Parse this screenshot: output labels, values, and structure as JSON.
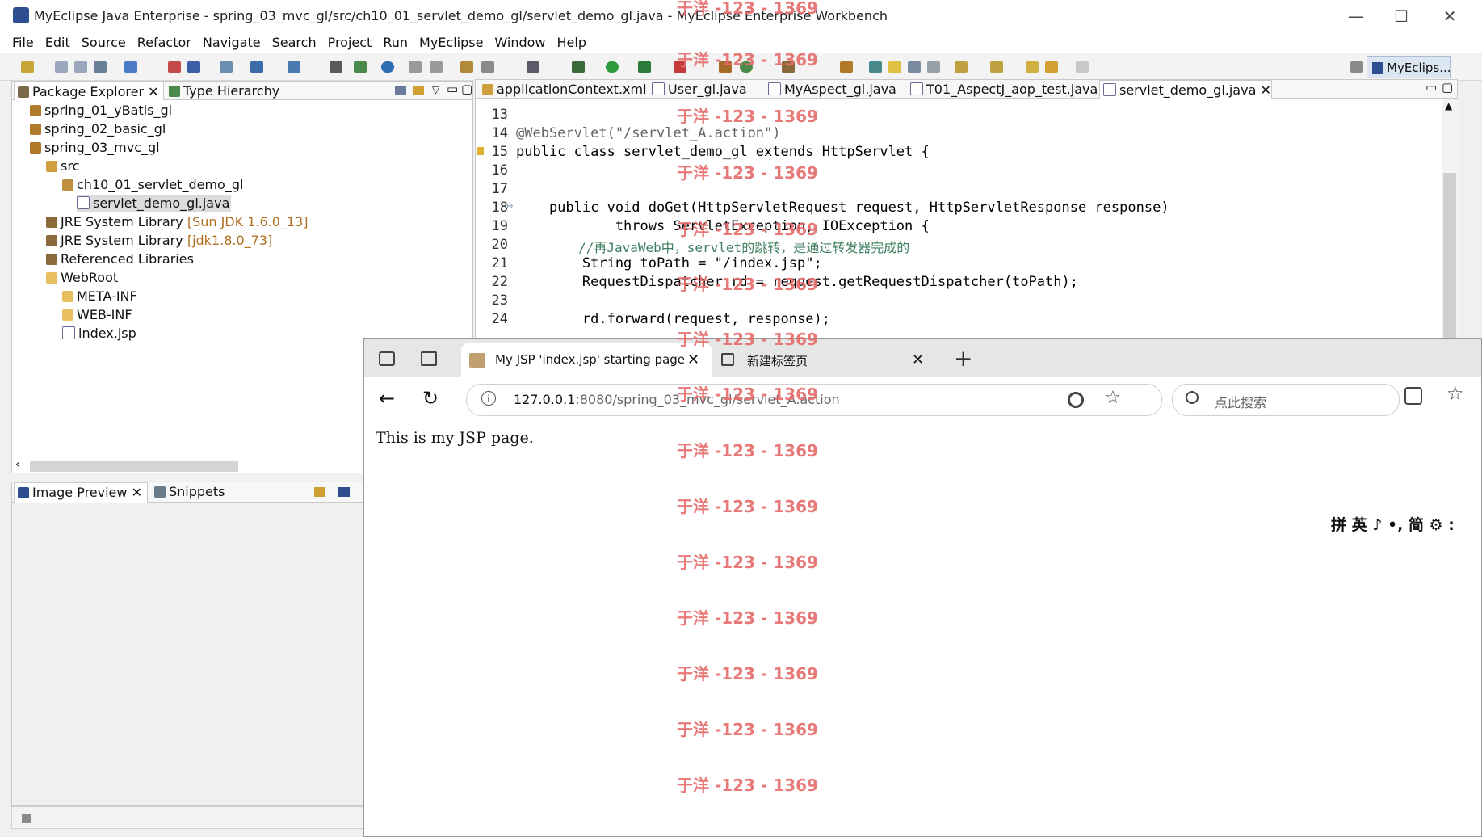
{
  "window": {
    "title": "MyEclipse Java Enterprise - spring_03_mvc_gl/src/ch10_01_servlet_demo_gl/servlet_demo_gl.java - MyEclipse Enterprise Workbench"
  },
  "menu": [
    "File",
    "Edit",
    "Source",
    "Refactor",
    "Navigate",
    "Search",
    "Project",
    "Run",
    "MyEclipse",
    "Window",
    "Help"
  ],
  "perspective": "MyEclips...",
  "left_tabs": {
    "package_explorer": "Package Explorer",
    "type_hierarchy": "Type Hierarchy"
  },
  "tree": [
    {
      "label": "spring_01_yBatis_gl",
      "deco": ""
    },
    {
      "label": "spring_02_basic_gl",
      "deco": ""
    },
    {
      "label": "spring_03_mvc_gl",
      "deco": ""
    },
    {
      "label": "src",
      "deco": ""
    },
    {
      "label": "ch10_01_servlet_demo_gl",
      "deco": ""
    },
    {
      "label": "servlet_demo_gl.java",
      "deco": ""
    },
    {
      "label": "JRE System Library",
      "deco": "[Sun JDK 1.6.0_13]"
    },
    {
      "label": "JRE System Library",
      "deco": "[jdk1.8.0_73]"
    },
    {
      "label": "Referenced Libraries",
      "deco": ""
    },
    {
      "label": "WebRoot",
      "deco": ""
    },
    {
      "label": "META-INF",
      "deco": ""
    },
    {
      "label": "WEB-INF",
      "deco": ""
    },
    {
      "label": "index.jsp",
      "deco": ""
    }
  ],
  "bottom_tabs": {
    "image_preview": "Image Preview",
    "snippets": "Snippets"
  },
  "editor_tabs": [
    "applicationContext.xml",
    "User_gl.java",
    "MyAspect_gl.java",
    "T01_AspectJ_aop_test.java",
    "servlet_demo_gl.java"
  ],
  "code_lines": [
    {
      "n": "13",
      "t": ""
    },
    {
      "n": "14",
      "t": "@WebServlet(\"/servlet_A.action\")"
    },
    {
      "n": "15",
      "t": "public class servlet_demo_gl extends HttpServlet {"
    },
    {
      "n": "16",
      "t": ""
    },
    {
      "n": "17",
      "t": ""
    },
    {
      "n": "18",
      "t": "    public void doGet(HttpServletRequest request, HttpServletResponse response)"
    },
    {
      "n": "19",
      "t": "            throws ServletException, IOException {"
    },
    {
      "n": "20",
      "t": "        //再JavaWeb中，servlet的跳转，是通过转发器完成的"
    },
    {
      "n": "21",
      "t": "        String toPath = \"/index.jsp\";"
    },
    {
      "n": "22",
      "t": "        RequestDispatcher rd = request.getRequestDispatcher(toPath);"
    },
    {
      "n": "23",
      "t": ""
    },
    {
      "n": "24",
      "t": "        rd.forward(request, response);"
    }
  ],
  "browser": {
    "tab_title": "My JSP 'index.jsp' starting page",
    "tab2_title": "新建标签页",
    "url_host": "127.0.0.1",
    "url_rest": ":8080/spring_03_mvc_gl/servlet_A.action",
    "search_placeholder": "点此搜索",
    "page_text": "This is my JSP page."
  },
  "ime": "拼 英 ♪ •, 简 ⚙ :",
  "watermark": "于洋 -123 - 1369"
}
